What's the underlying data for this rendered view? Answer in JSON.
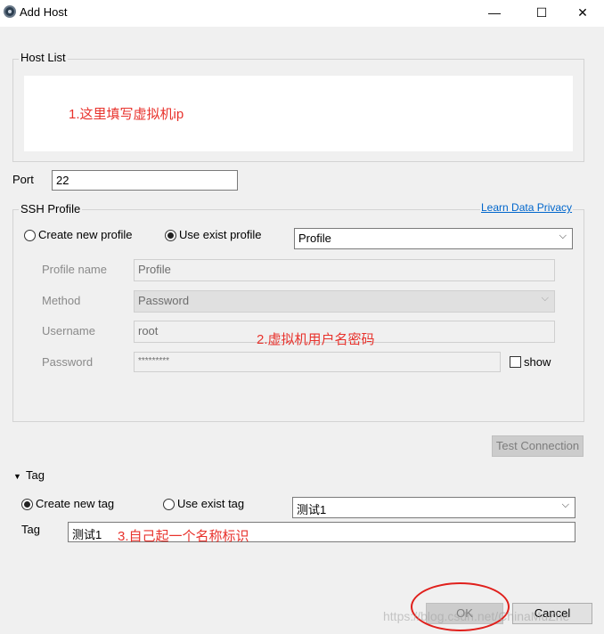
{
  "window": {
    "title": "Add Host",
    "minimize_glyph": "—",
    "maximize_glyph": "☐",
    "close_glyph": "✕"
  },
  "host_list": {
    "label": "Host List",
    "annotation": "1.这里填写虚拟机ip"
  },
  "port": {
    "label": "Port",
    "value": "22"
  },
  "ssh_profile": {
    "label": "SSH Profile",
    "privacy_link": "Learn Data Privacy",
    "radio_new": "Create new profile",
    "radio_exist": "Use exist profile",
    "selected_profile": "Profile",
    "profile_name_label": "Profile name",
    "profile_name_value": "Profile",
    "method_label": "Method",
    "method_value": "Password",
    "username_label": "Username",
    "username_value": "root",
    "password_label": "Password",
    "password_value": "*********",
    "show_label": "show",
    "annotation": "2.虚拟机用户名密码"
  },
  "test_connection": "Test Connection",
  "tag": {
    "section_label": "Tag",
    "radio_new": "Create new tag",
    "radio_exist": "Use exist tag",
    "selected_tag": "测试1",
    "tag_label": "Tag",
    "tag_value": "测试1",
    "annotation": "3.自己起一个名称标识"
  },
  "buttons": {
    "ok": "OK",
    "cancel": "Cancel"
  },
  "watermark": "https://blog.csdn.net/ChinaMuZhe",
  "colors": {
    "annotation": "#e8322c",
    "link": "#0066cc",
    "highlight_ellipse": "#e0201c"
  }
}
